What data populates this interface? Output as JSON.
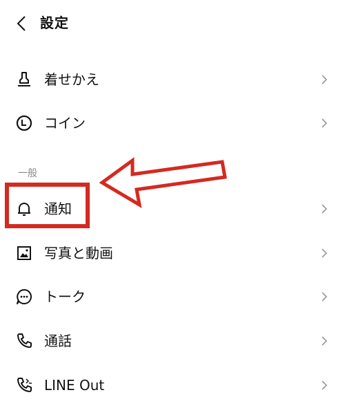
{
  "header": {
    "title": "設定",
    "back_icon": "chevron-left-icon"
  },
  "rows_top": [
    {
      "label": "着せかえ",
      "icon": "brush-icon"
    },
    {
      "label": "コイン",
      "icon": "coin-icon"
    }
  ],
  "section": {
    "label": "一般"
  },
  "rows_general": [
    {
      "label": "通知",
      "icon": "bell-icon"
    },
    {
      "label": "写真と動画",
      "icon": "image-icon"
    },
    {
      "label": "トーク",
      "icon": "chat-icon"
    },
    {
      "label": "通話",
      "icon": "phone-icon"
    },
    {
      "label": "LINE Out",
      "icon": "phone-out-icon"
    }
  ],
  "annotation": {
    "color": "#d42a20"
  }
}
